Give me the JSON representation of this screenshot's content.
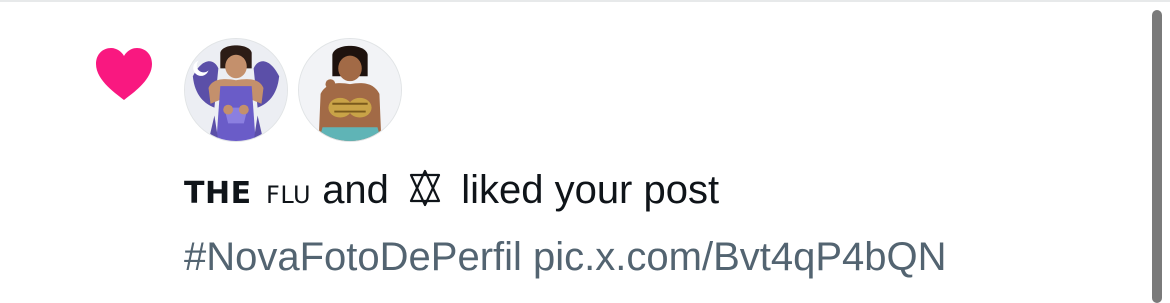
{
  "colors": {
    "heart": "#f91880",
    "primary_text": "#0f1419",
    "secondary_text": "#536471",
    "scrollbar": "#7a7a7a"
  },
  "notification": {
    "type_icon": "heart-icon",
    "users": [
      {
        "name_part_1": "THE",
        "name_part_2": "FLU",
        "avatar": "avatar-the-flu"
      },
      {
        "name_symbol": "✡",
        "name_icon": "pentagram-icon",
        "avatar": "avatar-second-user"
      }
    ],
    "connector": "and",
    "action_text": "liked your post",
    "post_preview": "#NovaFotoDePerfil pic.x.com/Bvt4qP4bQN"
  }
}
